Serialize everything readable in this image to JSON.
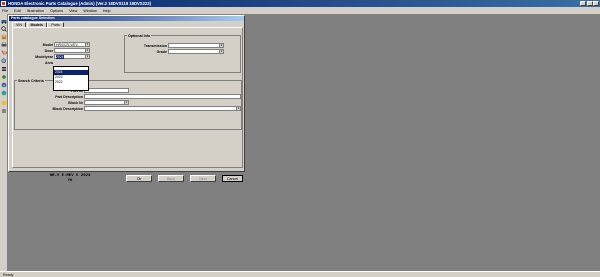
{
  "app": {
    "title": "HONDA Electronic Parts Catalogue (Admin)  (Ver.2  18DVS119  18DVS223)",
    "menu": [
      "File",
      "Edit",
      "Illustration",
      "Options",
      "View",
      "Window",
      "Help"
    ],
    "status": "Ready"
  },
  "dialog": {
    "title": "Parts catalogue Selection",
    "tabs": [
      "VIN",
      "Models",
      "Parts"
    ],
    "active_tab": "Models",
    "model": {
      "label": "Model",
      "value": "HRV/CR-V/EV"
    },
    "door": {
      "label": "Door",
      "value": ""
    },
    "modelyear": {
      "label": "Modelyear",
      "value": "2024"
    },
    "area": {
      "label": "Area"
    },
    "modelyear_options": [
      "2024",
      "2023",
      "2022"
    ],
    "optional_info": {
      "title": "Optional Info",
      "transmission": {
        "label": "Transmission",
        "value": ""
      },
      "grade": {
        "label": "Grade",
        "value": ""
      }
    },
    "search_criteria": {
      "title": "Search Criteria",
      "part_nr": "Part Nr",
      "part_description": "Part Description",
      "block_nr": "Block Nr",
      "block_description": "Block Description"
    },
    "footer_info": {
      "line1": "HR-V E:HEV  5  2024",
      "line2": "YK"
    },
    "buttons": {
      "ok": "Ok",
      "back": "Back",
      "next": "Next",
      "cancel": "Cancel"
    }
  }
}
